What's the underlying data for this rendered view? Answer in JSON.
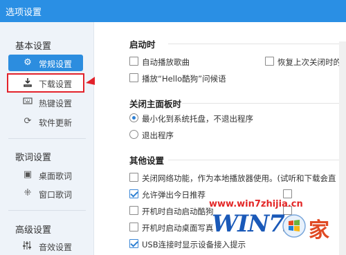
{
  "window": {
    "title": "选项设置"
  },
  "sidebar": {
    "groups": [
      {
        "label": "基本设置",
        "items": [
          {
            "label": "常规设置",
            "icon": "gear-icon"
          },
          {
            "label": "下载设置",
            "icon": "download-icon"
          },
          {
            "label": "热键设置",
            "icon": "keyboard-icon"
          },
          {
            "label": "软件更新",
            "icon": "refresh-icon"
          }
        ]
      },
      {
        "label": "歌词设置",
        "items": [
          {
            "label": "桌面歌词",
            "icon": "desktop-lyrics-icon"
          },
          {
            "label": "窗口歌词",
            "icon": "window-lyrics-icon"
          }
        ]
      },
      {
        "label": "高级设置",
        "items": [
          {
            "label": "音效设置",
            "icon": "equalizer-icon"
          }
        ]
      }
    ]
  },
  "sections": {
    "startup": {
      "title": "启动时",
      "options": [
        {
          "label": "自动播放歌曲",
          "checked": false
        },
        {
          "label": "恢复上次关闭时的界",
          "checked": false
        },
        {
          "label": "播放“Hello酷狗”问候语",
          "checked": false
        }
      ]
    },
    "close_panel": {
      "title": "关闭主面板时",
      "options": [
        {
          "label": "最小化到系统托盘，不退出程序",
          "selected": true
        },
        {
          "label": "退出程序",
          "selected": false
        }
      ]
    },
    "other": {
      "title": "其他设置",
      "options": [
        {
          "label": "关闭网络功能，作为本地播放器使用。(试听和下载会直",
          "checked": false
        },
        {
          "label": "允许弹出今日推荐",
          "checked": true
        },
        {
          "label": "开机时自动启动酷狗",
          "checked": false
        },
        {
          "label": "开机时启动桌面写真",
          "checked": false
        },
        {
          "label": "USB连接时显示设备接入提示",
          "checked": true
        }
      ],
      "right_checkboxes": 3
    }
  },
  "watermark": {
    "url": "www.win7zhijia.cn",
    "logo": "WIN7",
    "suffix": "家"
  },
  "colors": {
    "accent": "#2c8ddf",
    "titlebar": "#2a8fe4",
    "highlight": "#e2222b"
  }
}
